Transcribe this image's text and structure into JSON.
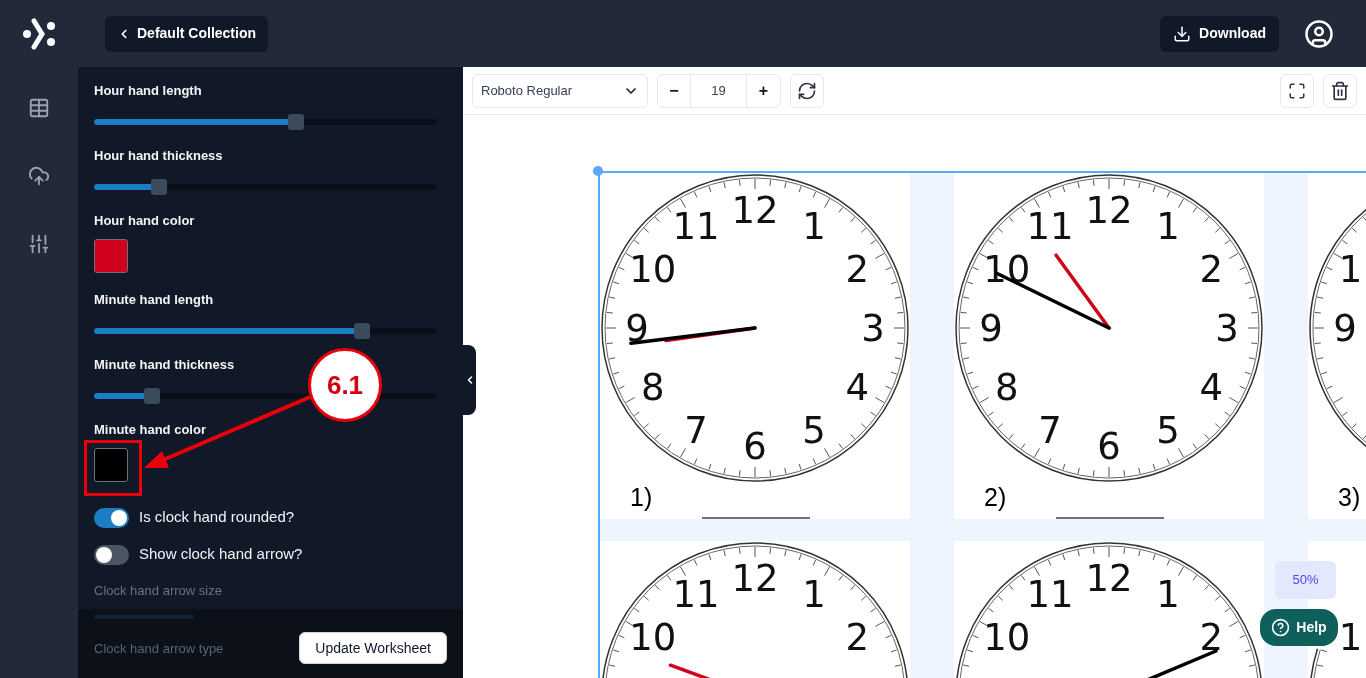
{
  "header": {
    "back_button": "Default Collection",
    "download_button": "Download"
  },
  "settings": [
    {
      "kind": "slider",
      "label": "Hour hand length",
      "level": 0.59
    },
    {
      "kind": "slider",
      "label": "Hour hand thickness",
      "level": 0.19
    },
    {
      "kind": "color",
      "label": "Hour hand color",
      "color": "#d0021b"
    },
    {
      "kind": "slider",
      "label": "Minute hand length",
      "level": 0.78
    },
    {
      "kind": "slider",
      "label": "Minute hand thickness",
      "level": 0.17
    },
    {
      "kind": "color",
      "label": "Minute hand color",
      "color": "#000000"
    },
    {
      "kind": "toggle",
      "label": "Is clock hand rounded?",
      "on": true
    },
    {
      "kind": "toggle",
      "label": "Show clock hand arrow?",
      "on": false
    },
    {
      "kind": "heading",
      "label": "Clock hand arrow size",
      "disabled": true
    }
  ],
  "footer": {
    "faded_label": "Clock hand arrow type",
    "button": "Update Worksheet"
  },
  "toolbar": {
    "font_select": "Roboto Regular",
    "font_size": "19",
    "minus": "−",
    "plus": "+"
  },
  "clocks": [
    {
      "kind": "full",
      "label": "1)",
      "numerals": [
        "12",
        "11",
        "1",
        "10",
        "2",
        "9",
        "3",
        "8",
        "4",
        "7",
        "5",
        "6"
      ]
    },
    {
      "kind": "full",
      "label": "2)",
      "numerals": [
        "12",
        "11",
        "1",
        "10",
        "2",
        "9",
        "3",
        "8",
        "4",
        "7",
        "5",
        "6"
      ]
    },
    {
      "kind": "edge",
      "label": "3)",
      "numerals": [
        "1",
        "9"
      ]
    },
    {
      "kind": "full",
      "numerals": [
        "12",
        "11",
        "1",
        "10",
        "2"
      ]
    },
    {
      "kind": "full",
      "numerals": [
        "12",
        "11",
        "1",
        "10",
        "2"
      ]
    },
    {
      "kind": "edge",
      "numerals": [
        "1"
      ]
    }
  ],
  "zoom_badge": "50%",
  "help_button": "Help",
  "annotation": {
    "label": "6.1"
  }
}
